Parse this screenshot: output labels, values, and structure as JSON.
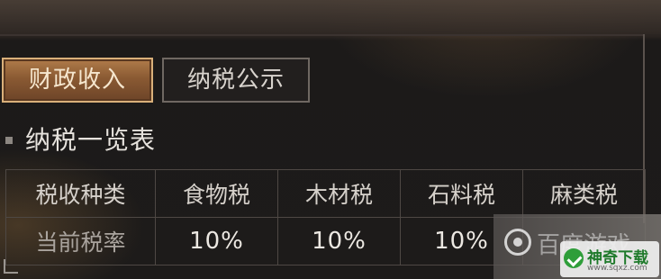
{
  "tabs": [
    {
      "label": "财政收入",
      "active": true
    },
    {
      "label": "纳税公示",
      "active": false
    }
  ],
  "section": {
    "title": "纳税一览表"
  },
  "tax_table": {
    "header_label": "税收种类",
    "row_label": "当前税率",
    "columns": [
      "食物税",
      "木材税",
      "石料税",
      "麻类税"
    ],
    "rates": [
      "10%",
      "10%",
      "10%",
      ""
    ]
  },
  "watermark": {
    "overlay_text": "百度游戏",
    "badge_name": "神奇下载",
    "badge_url": "www.sqxz.com"
  },
  "colors": {
    "active_tab": "#8a5a33",
    "active_tab_border": "#d9b07a",
    "inactive_tab_border": "#6f6862",
    "table_border": "#4e4844",
    "text": "#e4e0da"
  }
}
